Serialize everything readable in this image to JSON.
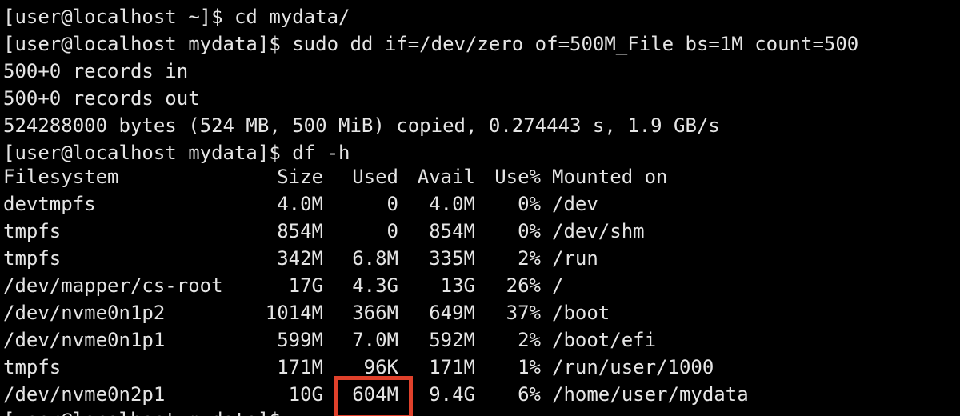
{
  "terminal": {
    "background": "#000000",
    "foreground": "#e5e5e5",
    "highlight_color": "#e0412b",
    "lines": [
      "[user@localhost ~]$ cd mydata/",
      "[user@localhost mydata]$ sudo dd if=/dev/zero of=500M_File bs=1M count=500",
      "500+0 records in",
      "500+0 records out",
      "524288000 bytes (524 MB, 500 MiB) copied, 0.274443 s, 1.9 GB/s",
      "[user@localhost mydata]$ df -h"
    ],
    "df": {
      "headers": {
        "filesystem": "Filesystem",
        "size": "Size",
        "used": "Used",
        "avail": "Avail",
        "use_pct": "Use%",
        "mounted": "Mounted on"
      },
      "rows": [
        {
          "filesystem": "devtmpfs",
          "size": "4.0M",
          "used": "0",
          "avail": "4.0M",
          "use_pct": "0%",
          "mounted": "/dev"
        },
        {
          "filesystem": "tmpfs",
          "size": "854M",
          "used": "0",
          "avail": "854M",
          "use_pct": "0%",
          "mounted": "/dev/shm"
        },
        {
          "filesystem": "tmpfs",
          "size": "342M",
          "used": "6.8M",
          "avail": "335M",
          "use_pct": "2%",
          "mounted": "/run"
        },
        {
          "filesystem": "/dev/mapper/cs-root",
          "size": "17G",
          "used": "4.3G",
          "avail": "13G",
          "use_pct": "26%",
          "mounted": "/"
        },
        {
          "filesystem": "/dev/nvme0n1p2",
          "size": "1014M",
          "used": "366M",
          "avail": "649M",
          "use_pct": "37%",
          "mounted": "/boot"
        },
        {
          "filesystem": "/dev/nvme0n1p1",
          "size": "599M",
          "used": "7.0M",
          "avail": "592M",
          "use_pct": "2%",
          "mounted": "/boot/efi"
        },
        {
          "filesystem": "tmpfs",
          "size": "171M",
          "used": "96K",
          "avail": "171M",
          "use_pct": "1%",
          "mounted": "/run/user/1000"
        },
        {
          "filesystem": "/dev/nvme0n2p1",
          "size": "10G",
          "used": "604M",
          "avail": "9.4G",
          "use_pct": "6%",
          "mounted": "/home/user/mydata"
        }
      ]
    },
    "partial_prompt": "[user@localhost mydata]$"
  }
}
